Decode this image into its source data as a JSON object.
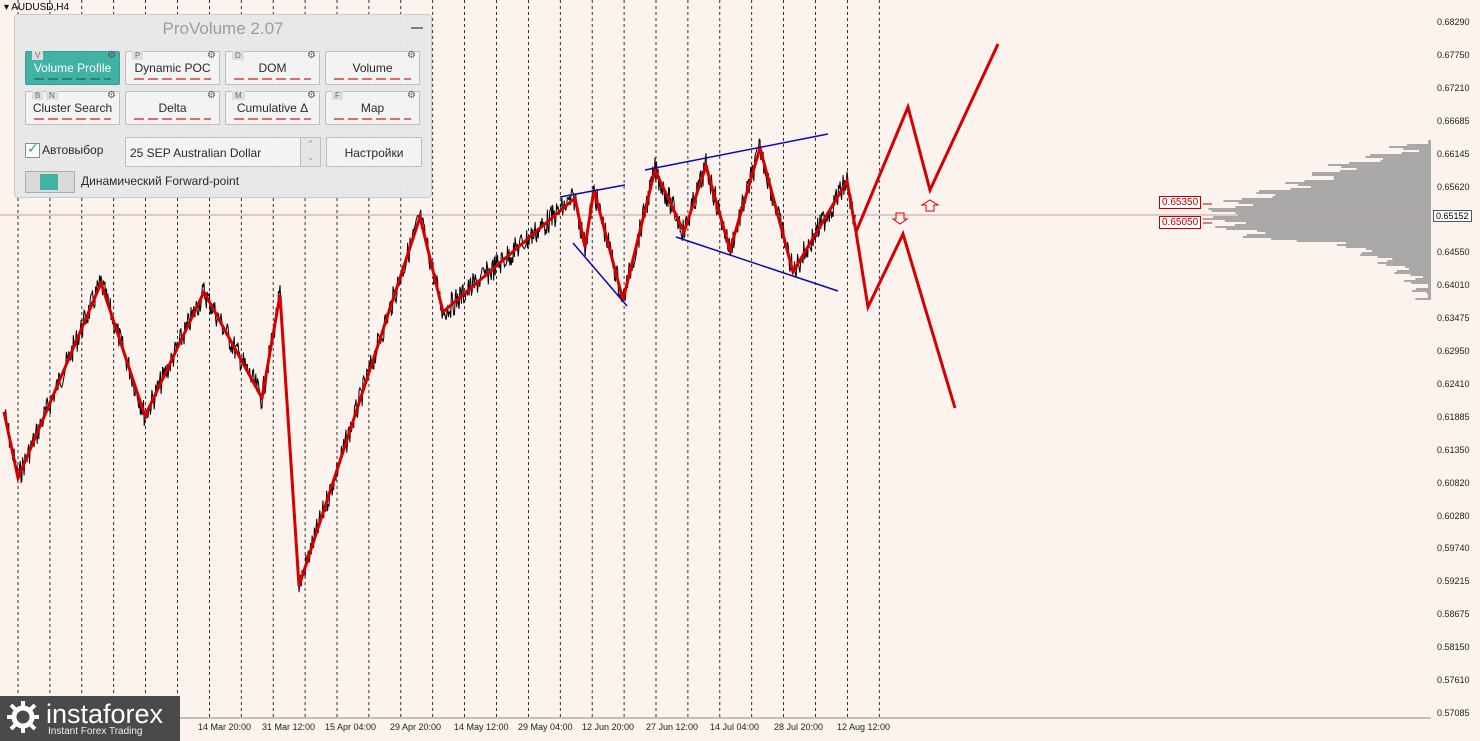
{
  "window": {
    "symbol": "AUDUSD,H4"
  },
  "panel": {
    "title": "ProVolume 2.07",
    "buttons": [
      {
        "label": "Volume Profile",
        "key": "V",
        "active": true
      },
      {
        "label": "Dynamic POC",
        "key": "P",
        "active": false
      },
      {
        "label": "DOM",
        "key": "D",
        "active": false
      },
      {
        "label": "Volume",
        "key": "",
        "active": false
      },
      {
        "label": "Cluster Search",
        "key": "B",
        "key2": "N",
        "active": false
      },
      {
        "label": "Delta",
        "key": "",
        "active": false
      },
      {
        "label": "Cumulative Δ",
        "key": "M",
        "active": false
      },
      {
        "label": "Map",
        "key": "F",
        "active": false
      }
    ],
    "autoselect_label": "Автовыбор",
    "autoselect_checked": true,
    "instrument_value": "25 SEP Australian Dollar",
    "settings_label": "Настройки",
    "forward_label": "Динамический Forward-point"
  },
  "price_axis": {
    "ticks": [
      "0.68290",
      "0.67750",
      "0.67210",
      "0.66685",
      "0.66145",
      "0.65620",
      "0.65080",
      "0.64550",
      "0.64010",
      "0.63475",
      "0.62950",
      "0.62410",
      "0.61885",
      "0.61350",
      "0.60820",
      "0.60280",
      "0.59740",
      "0.59215",
      "0.58675",
      "0.58150",
      "0.57610",
      "0.57085"
    ],
    "current_price": "0.65152"
  },
  "levels": [
    "0.65350",
    "0.65050"
  ],
  "time_axis": {
    "ticks": [
      "14 Mar 20:00",
      "31 Mar 12:00",
      "15 Apr 04:00",
      "29 Apr 20:00",
      "14 May 12:00",
      "29 May 04:00",
      "12 Jun 20:00",
      "27 Jun 12:00",
      "14 Jul 04:00",
      "28 Jul 20:00",
      "12 Aug 12:00"
    ]
  },
  "colors": {
    "zigzag": "#d40000",
    "channel": "#0a0ab0",
    "price": "#000000",
    "accent": "#3bb0a3",
    "background": "#fdf3ee"
  },
  "logo": {
    "main": "instaforex",
    "sub": "Instant Forex Trading"
  }
}
